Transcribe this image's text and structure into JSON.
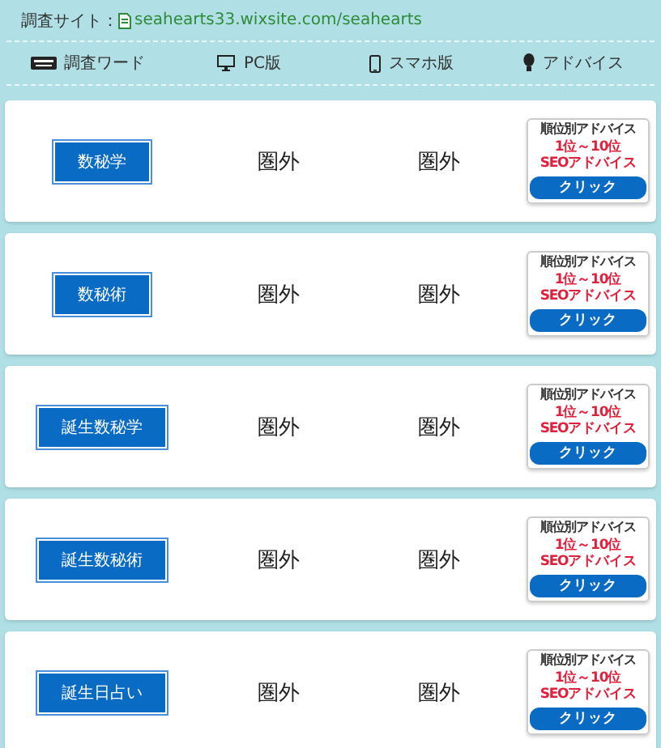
{
  "site": {
    "label": "調査サイト：",
    "url": "seahearts33.wixsite.com/seahearts"
  },
  "columns": [
    {
      "kind": "keyboard",
      "label": "調査ワード"
    },
    {
      "kind": "monitor",
      "label": "PC版"
    },
    {
      "kind": "phone",
      "label": "スマホ版"
    },
    {
      "kind": "bulb",
      "label": "アドバイス"
    }
  ],
  "rows": [
    {
      "keyword": "数秘学",
      "pc": "圏外",
      "sp": "圏外",
      "advice": {
        "title": "順位別アドバイス",
        "range": "1位～10位",
        "sub": "SEOアドバイス",
        "button": "クリック"
      }
    },
    {
      "keyword": "数秘術",
      "pc": "圏外",
      "sp": "圏外",
      "advice": {
        "title": "順位別アドバイス",
        "range": "1位～10位",
        "sub": "SEOアドバイス",
        "button": "クリック"
      }
    },
    {
      "keyword": "誕生数秘学",
      "pc": "圏外",
      "sp": "圏外",
      "advice": {
        "title": "順位別アドバイス",
        "range": "1位～10位",
        "sub": "SEOアドバイス",
        "button": "クリック"
      }
    },
    {
      "keyword": "誕生数秘術",
      "pc": "圏外",
      "sp": "圏外",
      "advice": {
        "title": "順位別アドバイス",
        "range": "1位～10位",
        "sub": "SEOアドバイス",
        "button": "クリック"
      }
    },
    {
      "keyword": "誕生日占い",
      "pc": "圏外",
      "sp": "圏外",
      "advice": {
        "title": "順位別アドバイス",
        "range": "1位～10位",
        "sub": "SEOアドバイス",
        "button": "クリック"
      }
    }
  ]
}
